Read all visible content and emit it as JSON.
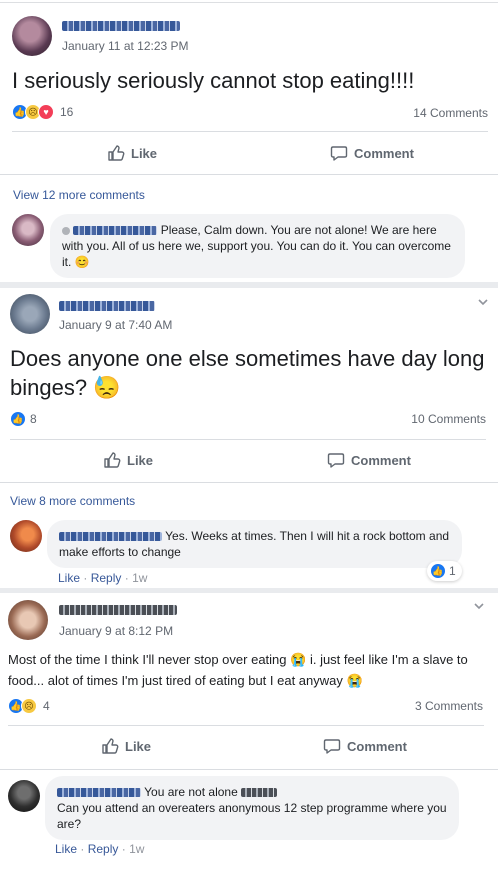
{
  "posts": [
    {
      "date": "January 11 at 12:23 PM",
      "text": "I seriously seriously cannot stop eating!!!!",
      "reaction_count": "16",
      "comments_count": "14 Comments",
      "like_label": "Like",
      "comment_label": "Comment",
      "view_more": "View 12 more comments",
      "comment": {
        "text": "Please, Calm down. You are not alone! We are here with you. All of us here we, support you. You can do it. You can overcome it.",
        "emoji": "😊"
      }
    },
    {
      "date": "January 9 at 7:40 AM",
      "text": "Does anyone one else sometimes have day long binges?",
      "emoji": "😓",
      "reaction_count": "8",
      "comments_count": "10 Comments",
      "like_label": "Like",
      "comment_label": "Comment",
      "view_more": "View 8 more comments",
      "comment": {
        "text": "Yes. Weeks at times. Then I will hit a rock bottom and make efforts to change",
        "like": "Like",
        "reply": "Reply",
        "age": "1w",
        "reaction_count": "1"
      }
    },
    {
      "date": "January 9 at 8:12 PM",
      "text_1": "Most of the time I think I'll never stop over eating",
      "text_2": "i. just feel like I'm a slave to food... alot of times I'm just tired of eating but I eat anyway",
      "emoji": "😭",
      "reaction_count": "4",
      "comments_count": "3 Comments",
      "like_label": "Like",
      "comment_label": "Comment",
      "comment": {
        "text_1": "You are not alone",
        "text_2": "Can you attend an overeaters anonymous 12 step programme where you are?",
        "like": "Like",
        "reply": "Reply",
        "age": "1w"
      }
    }
  ],
  "separator": "·"
}
